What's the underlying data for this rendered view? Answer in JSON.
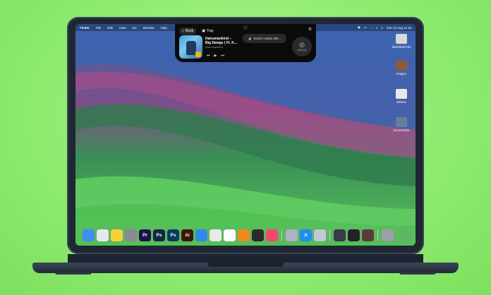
{
  "menubar": {
    "items": [
      "Finder",
      "File",
      "Edit",
      "View",
      "Go",
      "Window",
      "Help"
    ],
    "clock": "Tue 13 Aug 11:16"
  },
  "notch": {
    "tabs": [
      {
        "label": "Nook",
        "icon": "music-note-icon",
        "active": true
      },
      {
        "label": "Tray",
        "icon": "tray-icon",
        "active": false
      }
    ],
    "track": {
      "title_line1": "Hanumankind –",
      "title_line2": "Big Dawgs | Ft. K...",
      "artist": "Hanumankind"
    },
    "airdrop_search": "Search Adobe tahr...",
    "airdrop_label": "AirDrop"
  },
  "desktop_icons": [
    {
      "label": "Macintosh HD",
      "color": "#d8d8d8"
    },
    {
      "label": "Images",
      "color": "#8e5a3a"
    },
    {
      "label": "Movies",
      "color": "#e9e9e9"
    },
    {
      "label": "Screenshots",
      "color": "#6a7c9a"
    }
  ],
  "dock": {
    "apps": [
      {
        "name": "Finder",
        "glyph": "",
        "color": "#3d8ff0"
      },
      {
        "name": "Launchpad",
        "glyph": "",
        "color": "#e8e8ec"
      },
      {
        "name": "Notes",
        "glyph": "",
        "color": "#f7d13a"
      },
      {
        "name": "System Settings",
        "glyph": "",
        "color": "#8a8a90"
      },
      {
        "name": "Premiere Pro",
        "glyph": "Pr",
        "color": "#1a1446"
      },
      {
        "name": "Photoshop",
        "glyph": "Ps",
        "color": "#0e2743"
      },
      {
        "name": "Photoshop Beta",
        "glyph": "Ps",
        "color": "#0a3a5e"
      },
      {
        "name": "Illustrator",
        "glyph": "Ai",
        "color": "#3a1800"
      },
      {
        "name": "Safari",
        "glyph": "",
        "color": "#2f8be8"
      },
      {
        "name": "Chrome",
        "glyph": "",
        "color": "#e9e9e9"
      },
      {
        "name": "Slack",
        "glyph": "",
        "color": "#ffffff"
      },
      {
        "name": "VLC",
        "glyph": "",
        "color": "#f08a1c"
      },
      {
        "name": "Final Cut Pro",
        "glyph": "",
        "color": "#2b2b2b"
      },
      {
        "name": "Creative Cloud",
        "glyph": "",
        "color": "#f04a6a"
      },
      {
        "name": "Preview",
        "glyph": "",
        "color": "#a9b5c6"
      },
      {
        "name": "App Store",
        "glyph": "A",
        "color": "#1e8ff2"
      },
      {
        "name": "Image Capture",
        "glyph": "",
        "color": "#c2c8d4"
      },
      {
        "name": "Minimized 1",
        "glyph": "",
        "color": "#3a3a48"
      },
      {
        "name": "Minimized 2",
        "glyph": "",
        "color": "#222229"
      },
      {
        "name": "Minimized 3",
        "glyph": "",
        "color": "#5a3b3b"
      },
      {
        "name": "Trash",
        "glyph": "",
        "color": "#9aa0a6"
      }
    ]
  }
}
